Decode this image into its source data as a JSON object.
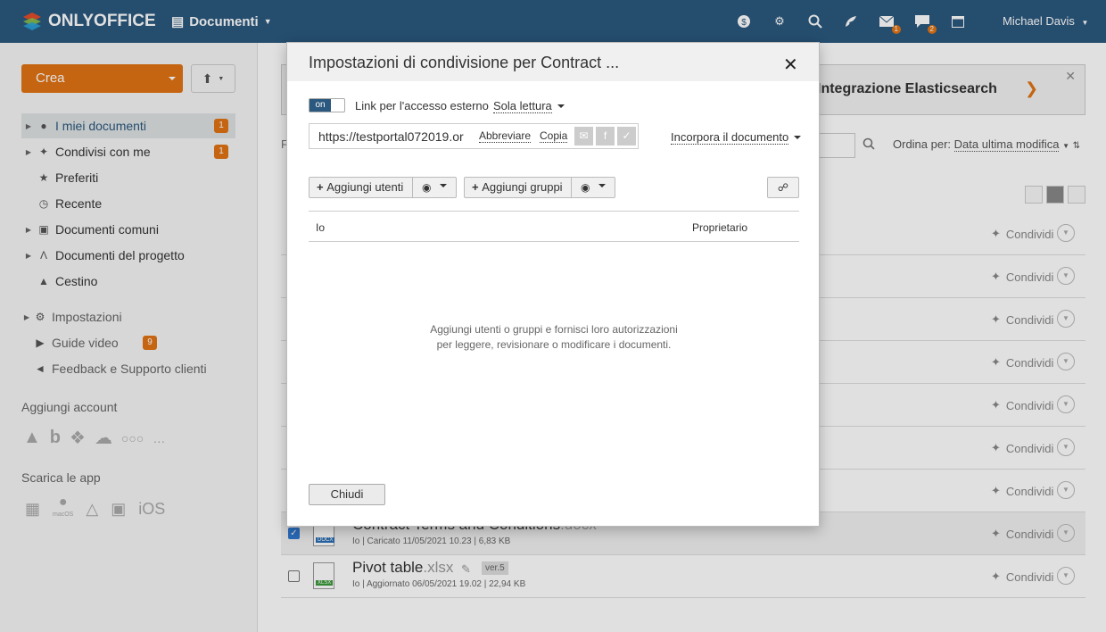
{
  "header": {
    "brand": "ONLYOFFICE",
    "module": "Documenti",
    "mail_badge": "1",
    "chat_badge": "2",
    "user": "Michael Davis"
  },
  "sidebar": {
    "create": "Crea",
    "items": [
      {
        "label": "I miei documenti",
        "count": "1"
      },
      {
        "label": "Condivisi con me",
        "count": "1"
      },
      {
        "label": "Preferiti"
      },
      {
        "label": "Recente"
      },
      {
        "label": "Documenti comuni"
      },
      {
        "label": "Documenti del progetto"
      },
      {
        "label": "Cestino"
      },
      {
        "label": "Impostazioni"
      },
      {
        "label": "Guide video",
        "count": "9"
      },
      {
        "label": "Feedback e Supporto clienti"
      }
    ],
    "add_account": "Aggiungi account",
    "download_apps": "Scarica le app",
    "ios": "iOS",
    "macos": "macOS"
  },
  "main": {
    "promo": "Integrazione Elasticsearch",
    "filter_label": "F",
    "sort_label": "Ordina per:",
    "sort_value": "Data ultima modifica",
    "share_label": "Condividi",
    "files": [
      {
        "name": "Contract Terms and Conditions",
        "ext": ".docx",
        "meta": "Io | Caricato 11/05/2021 10.23 | 6,83 KB",
        "type": "DOCX"
      },
      {
        "name": "Pivot table",
        "ext": ".xlsx",
        "meta": "Io | Aggiornato 06/05/2021 19.02 | 22,94 KB",
        "version": "ver.5",
        "type": "XLSX"
      }
    ]
  },
  "dialog": {
    "title": "Impostazioni di condivisione per Contract ...",
    "toggle": "on",
    "external_link_label": "Link per l'accesso esterno",
    "access": "Sola lettura",
    "url": "https://testportal072019.or",
    "shorten": "Abbreviare",
    "copy": "Copia",
    "embed": "Incorpora il documento",
    "add_users": "Aggiungi utenti",
    "add_groups": "Aggiungi gruppi",
    "owner_name": "Io",
    "owner_role": "Proprietario",
    "empty_line1": "Aggiungi utenti o gruppi e fornisci loro autorizzazioni",
    "empty_line2": "per leggere, revisionare o modificare i documenti.",
    "close": "Chiudi"
  }
}
